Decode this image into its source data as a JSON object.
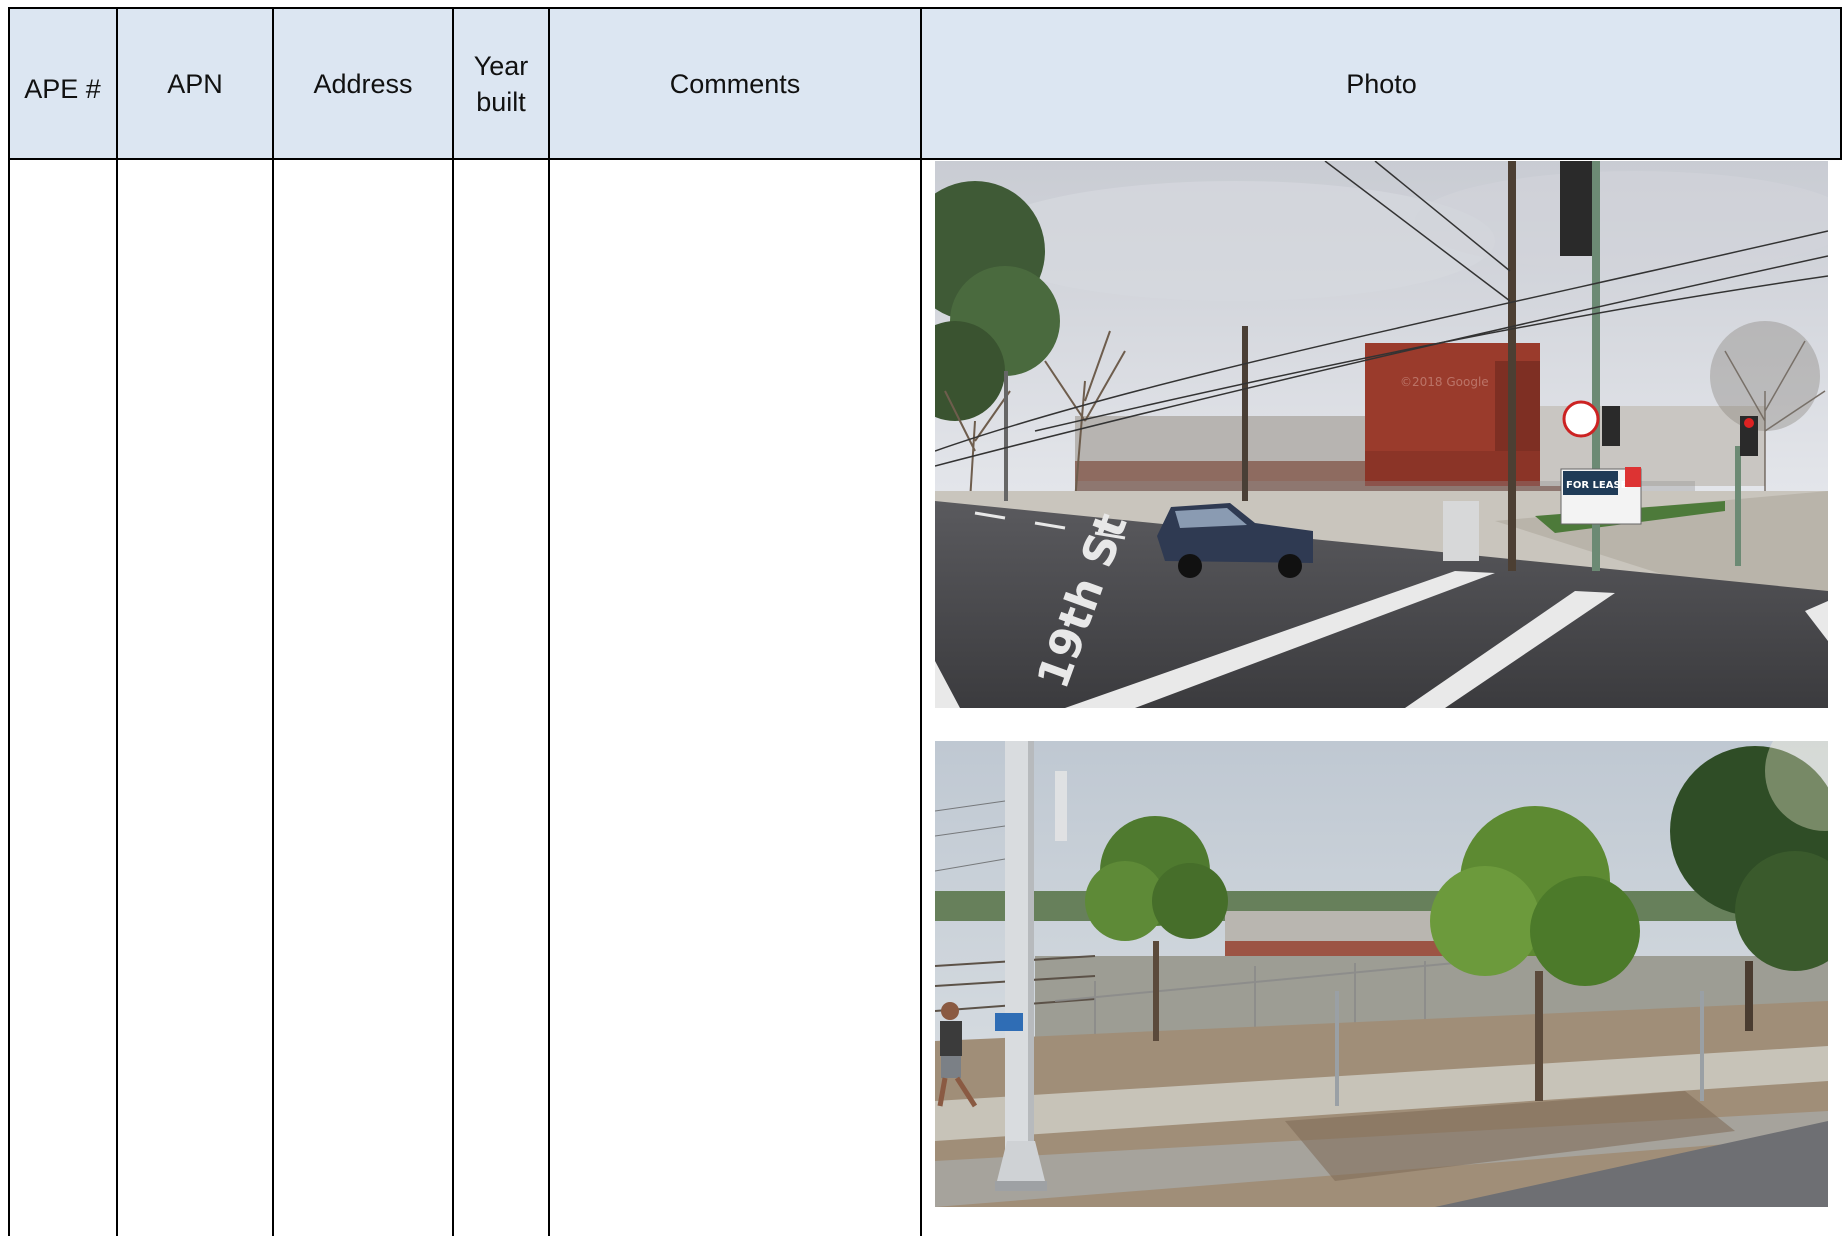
{
  "table": {
    "headers": {
      "ape": "APE #",
      "apn": "APN",
      "address": "Address",
      "year_line1": "Year",
      "year_line2": "built",
      "comments": "Comments",
      "photo": "Photo"
    },
    "row": {
      "ape": "",
      "apn": "",
      "address": "",
      "year_built": "",
      "comments": ""
    }
  },
  "photos": [
    {
      "subject": "street-intersection-brick-building",
      "street_label": "19th St",
      "sign_text": "FOR LEASE",
      "watermark": "©2018 Google"
    },
    {
      "subject": "fenced-lot-trees-railway"
    }
  ],
  "colors": {
    "header_bg": "#dce6f2",
    "border": "#000000"
  }
}
